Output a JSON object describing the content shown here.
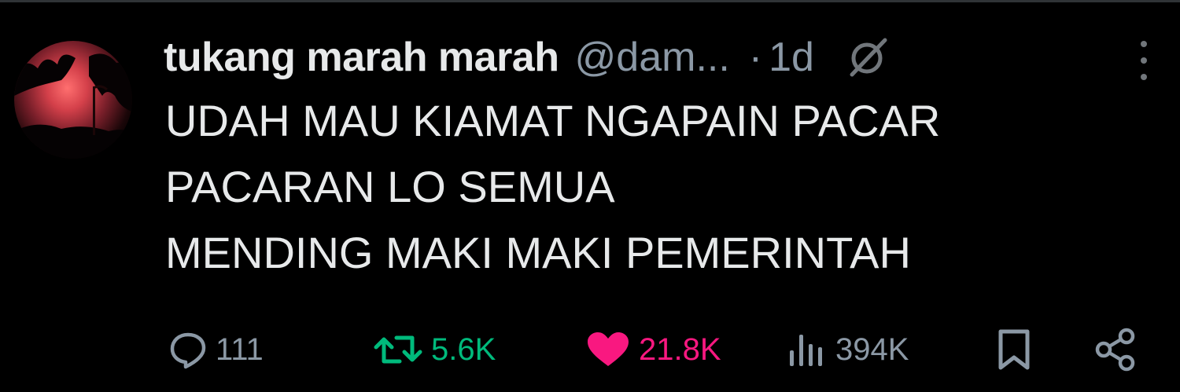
{
  "tweet": {
    "author_name": "tukang marah marah",
    "handle": "@dam...",
    "separator": "·",
    "time": "1d",
    "lines": [
      "UDAH MAU KIAMAT NGAPAIN PACAR",
      "PACARAN LO SEMUA",
      "MENDING MAKI MAKI PEMERINTAH"
    ]
  },
  "actions": {
    "replies": "111",
    "retweets": "5.6K",
    "likes": "21.8K",
    "views": "394K"
  },
  "icons": {
    "grok": "grok-icon",
    "more": "more-icon",
    "reply": "reply-icon",
    "retweet": "retweet-icon",
    "like": "heart-icon",
    "views": "views-icon",
    "bookmark": "bookmark-icon",
    "share": "share-icon"
  },
  "colors": {
    "background": "#000000",
    "text": "#e7e9ea",
    "muted": "#8b98a5",
    "retweet": "#00ba7c",
    "like": "#f91880"
  }
}
